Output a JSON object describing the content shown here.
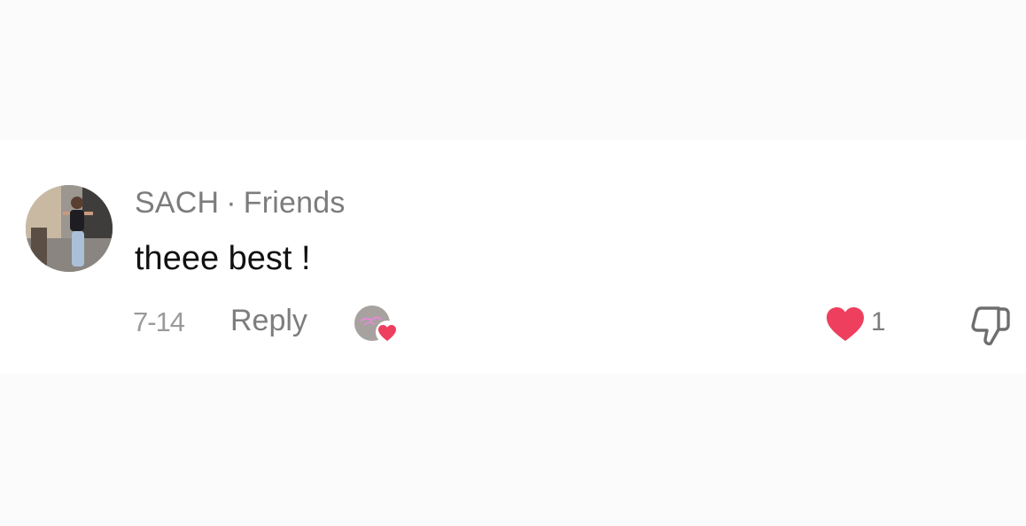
{
  "comment": {
    "username": "SACH",
    "separator": "·",
    "relation": "Friends",
    "text": "theee best !",
    "date": "7-14",
    "reply_label": "Reply",
    "like_count": "1",
    "liked": true,
    "liked_by_creator": true
  },
  "colors": {
    "heart": "#ee3f5f",
    "meta_text": "#7c7c7c",
    "body_text": "#111111"
  },
  "icons": {
    "avatar": "user-avatar-photo",
    "creator_like": "creator-liked-heart-icon",
    "like": "heart-icon",
    "dislike": "thumbs-down-icon"
  }
}
